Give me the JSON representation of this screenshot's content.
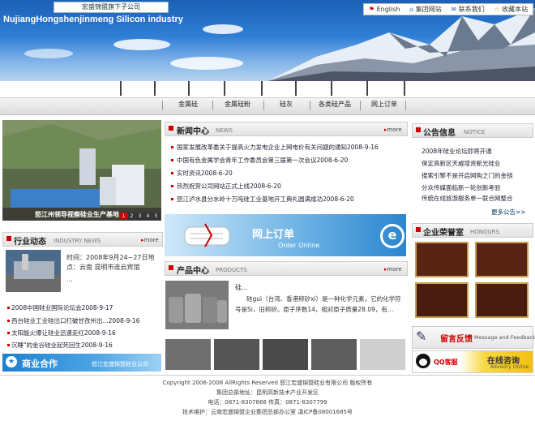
{
  "header": {
    "parent_company": "宏盛锦盟旗下子公司",
    "site_name": "NujiangHongshenjinmeng Silicon industry",
    "links": [
      "English",
      "集团网站",
      "联系我们",
      "收藏本站"
    ]
  },
  "nav": {
    "items": [
      "金属硅",
      "金属硅粉",
      "硅灰",
      "各类硅产品",
      "网上订单"
    ]
  },
  "slideshow": {
    "caption": "怒江州领导视察硅业生产基地",
    "pages": [
      "1",
      "2",
      "3",
      "4",
      "5"
    ]
  },
  "news": {
    "title": "新闻中心",
    "en": "NEWS",
    "more": "more",
    "items": [
      "国家发展改革委关于提高火力发电企业上网电价有关问题的通知2008-9-16",
      "中国有色金属学会青年工作委员会第三届第一次会议2008-6-20",
      "实时资讯2008-6-20",
      "热烈祝贺公司网站正式上线2008-6-20",
      "怒江泸水县分水岭十万吨硅工业基地开工典礼圆满成功2008-6-20"
    ]
  },
  "notice": {
    "title": "公告信息",
    "en": "NOTICE",
    "more": "更多公告>>",
    "items": [
      "2008年硅业论坛即将开通",
      "保定高新区天威增资新光硅业",
      "搜索引擎不是开启网购之门的金钥",
      "分众传媒面临新一轮创新考验",
      "传统在线旅游服务单一联合网整合"
    ]
  },
  "industry": {
    "title": "行业动态",
    "en": "INDUSTRY NEWS",
    "more": "more",
    "summary": "时间：2008年9月24~27日地点：云南 昆明市连云宾馆",
    "ellipsis": "…",
    "items": [
      "2008中国硅业国际论坛会2008-9-17",
      "西台硅业工业硅出口打破甘孜州出...2008-9-16",
      "太阳能火爆让硅业迅速走红2008-9-16",
      "沉睡\"的金谷硅业起死回生2008-9-16"
    ]
  },
  "order_banner": {
    "cn": "网上订单",
    "en": "Order Online"
  },
  "products": {
    "title": "产品中心",
    "en": "PRODUCTS",
    "more": "more",
    "name": "硅...",
    "desc": "硅gui（台湾、香港称矽xi）是一种化学元素，它的化学符号是Si，旧称矽。原子序数14，相对原子质量28.09，有…"
  },
  "honours": {
    "title": "企业荣誉室",
    "en": "HONOURS"
  },
  "cooperation": {
    "cn": "商业合作",
    "company": "怒江宏盛锦盟硅业公司"
  },
  "message": {
    "cn": "留言反馈",
    "en": "Message and Feedback"
  },
  "qq": {
    "label": "QQ客服",
    "cn": "在线咨询",
    "en": "Advisory Online"
  },
  "footer": {
    "copyright": "Copyright 2006-2008 AllRights Reserved 怒江宏盛锦盟硅业有限公司 版权所有",
    "address": "集团总部地址：昆明高新技术产业开发区",
    "phone": "电话：0871-8307866  传真：0871-8307799",
    "support": "技术维护：云南宏盛锦盟企业集团总部办公室 滇ICP备08001685号"
  },
  "colors": {
    "accent_red": "#cc0000",
    "header_blue": "#2f7fd6",
    "banner_blue": "#1e7fd0"
  }
}
